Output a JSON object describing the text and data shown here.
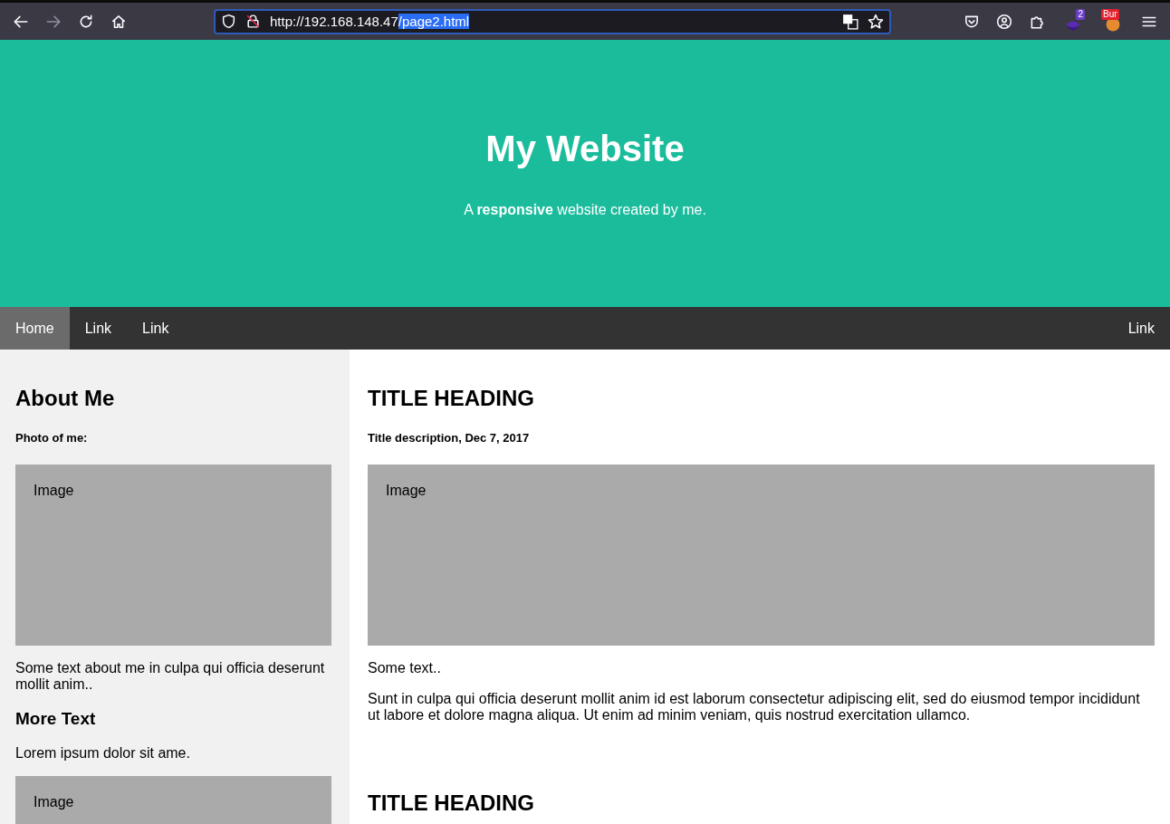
{
  "browser": {
    "url": "http://192.168.148.47",
    "url_selected": "/page2.html",
    "badges": [
      {
        "kind": "stack",
        "text": "2"
      },
      {
        "kind": "burp",
        "text": "Bur"
      }
    ]
  },
  "header": {
    "title": "My Website",
    "subtitle": "A **responsive** website created by me."
  },
  "nav": {
    "left": [
      {
        "label": "Home",
        "selected": true
      },
      {
        "label": "Link",
        "selected": false
      },
      {
        "label": "Link",
        "selected": false
      }
    ],
    "right": [
      {
        "label": "Link",
        "selected": false
      }
    ]
  },
  "sidebar": {
    "heading": "About Me",
    "caption": "Photo of me:",
    "image": "Image",
    "text": "Some text about me in culpa qui officia deserunt mollit anim..",
    "subheading": "More Text",
    "text2": "Lorem ipsum dolor sit ame.",
    "image2": "Image"
  },
  "posts": [
    {
      "title": "TITLE HEADING",
      "description": "Title description, Dec 7, 2017",
      "image": "Image",
      "text": "Some text..",
      "body": "Sunt in culpa qui officia deserunt mollit anim id est laborum consectetur adipiscing elit, sed do eiusmod tempor incididunt ut labore et dolore magna aliqua. Ut enim ad minim veniam, quis nostrud exercitation ullamco."
    },
    {
      "title": "TITLE HEADING"
    }
  ]
}
